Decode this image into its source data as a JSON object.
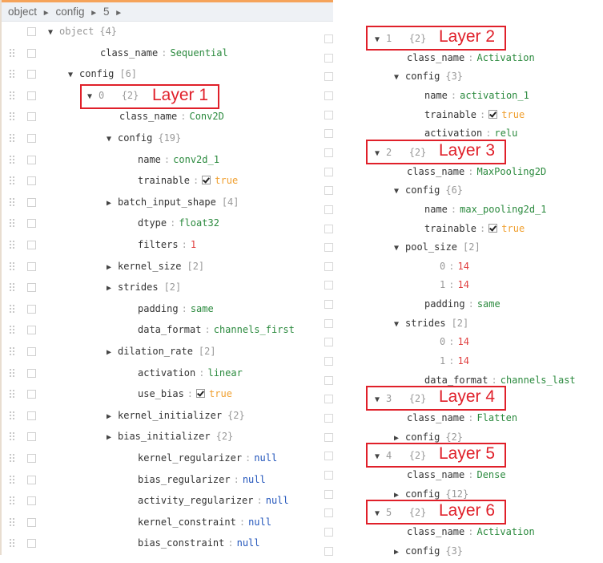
{
  "breadcrumb": {
    "items": [
      "object",
      "config",
      "5"
    ],
    "separator": "►"
  },
  "colors": {
    "accent_top": "#f5a35a",
    "string": "#2b8a3e",
    "number": "#e04040",
    "boolean": "#f0a030",
    "null": "#2255bb",
    "annotation": "#e0202a"
  },
  "left": {
    "rows": [
      {
        "indent": 0,
        "toggle": "▼",
        "key": "object",
        "meta": "{4}",
        "keyMuted": true,
        "grip": false
      },
      {
        "indent": 2,
        "key": "class_name",
        "value": "Sequential",
        "type": "str"
      },
      {
        "indent": 1,
        "toggle": "▼",
        "key": "config",
        "meta": "[6]"
      },
      {
        "indent": 2,
        "toggle": "▼",
        "idx": "0",
        "meta": "{2}"
      },
      {
        "indent": 4,
        "key": "class_name",
        "value": "Conv2D",
        "type": "str"
      },
      {
        "indent": 3,
        "toggle": "▼",
        "key": "config",
        "meta": "{19}"
      },
      {
        "indent": 5,
        "key": "name",
        "value": "conv2d_1",
        "type": "str"
      },
      {
        "indent": 5,
        "key": "trainable",
        "value": "true",
        "type": "bool",
        "checkbox": true
      },
      {
        "indent": 4,
        "toggle": "▶",
        "key": "batch_input_shape",
        "meta": "[4]"
      },
      {
        "indent": 5,
        "key": "dtype",
        "value": "float32",
        "type": "str"
      },
      {
        "indent": 5,
        "key": "filters",
        "value": "1",
        "type": "num"
      },
      {
        "indent": 4,
        "toggle": "▶",
        "key": "kernel_size",
        "meta": "[2]"
      },
      {
        "indent": 4,
        "toggle": "▶",
        "key": "strides",
        "meta": "[2]"
      },
      {
        "indent": 5,
        "key": "padding",
        "value": "same",
        "type": "str"
      },
      {
        "indent": 5,
        "key": "data_format",
        "value": "channels_first",
        "type": "str"
      },
      {
        "indent": 4,
        "toggle": "▶",
        "key": "dilation_rate",
        "meta": "[2]"
      },
      {
        "indent": 5,
        "key": "activation",
        "value": "linear",
        "type": "str"
      },
      {
        "indent": 5,
        "key": "use_bias",
        "value": "true",
        "type": "bool",
        "checkbox": true
      },
      {
        "indent": 4,
        "toggle": "▶",
        "key": "kernel_initializer",
        "meta": "{2}"
      },
      {
        "indent": 4,
        "toggle": "▶",
        "key": "bias_initializer",
        "meta": "{2}"
      },
      {
        "indent": 5,
        "key": "kernel_regularizer",
        "value": "null",
        "type": "null"
      },
      {
        "indent": 5,
        "key": "bias_regularizer",
        "value": "null",
        "type": "null"
      },
      {
        "indent": 5,
        "key": "activity_regularizer",
        "value": "null",
        "type": "null"
      },
      {
        "indent": 5,
        "key": "kernel_constraint",
        "value": "null",
        "type": "null"
      },
      {
        "indent": 5,
        "key": "bias_constraint",
        "value": "null",
        "type": "null"
      }
    ]
  },
  "right": {
    "rows": [
      {
        "indent": 0,
        "toggle": "▼",
        "idx": "1",
        "meta": "{2}"
      },
      {
        "indent": 2,
        "key": "class_name",
        "value": "Activation",
        "type": "str"
      },
      {
        "indent": 1,
        "toggle": "▼",
        "key": "config",
        "meta": "{3}"
      },
      {
        "indent": 3,
        "key": "name",
        "value": "activation_1",
        "type": "str"
      },
      {
        "indent": 3,
        "key": "trainable",
        "value": "true",
        "type": "bool",
        "checkbox": true
      },
      {
        "indent": 3,
        "key": "activation",
        "value": "relu",
        "type": "str"
      },
      {
        "indent": 0,
        "toggle": "▼",
        "idx": "2",
        "meta": "{2}"
      },
      {
        "indent": 2,
        "key": "class_name",
        "value": "MaxPooling2D",
        "type": "str"
      },
      {
        "indent": 1,
        "toggle": "▼",
        "key": "config",
        "meta": "{6}"
      },
      {
        "indent": 3,
        "key": "name",
        "value": "max_pooling2d_1",
        "type": "str"
      },
      {
        "indent": 3,
        "key": "trainable",
        "value": "true",
        "type": "bool",
        "checkbox": true
      },
      {
        "indent": 2,
        "toggle": "▼",
        "key": "pool_size",
        "meta": "[2]"
      },
      {
        "indent": 4,
        "idxKey": "0",
        "value": "14",
        "type": "num"
      },
      {
        "indent": 4,
        "idxKey": "1",
        "value": "14",
        "type": "num"
      },
      {
        "indent": 3,
        "key": "padding",
        "value": "same",
        "type": "str"
      },
      {
        "indent": 2,
        "toggle": "▼",
        "key": "strides",
        "meta": "[2]"
      },
      {
        "indent": 4,
        "idxKey": "0",
        "value": "14",
        "type": "num"
      },
      {
        "indent": 4,
        "idxKey": "1",
        "value": "14",
        "type": "num"
      },
      {
        "indent": 3,
        "key": "data_format",
        "value": "channels_last",
        "type": "str"
      },
      {
        "indent": 0,
        "toggle": "▼",
        "idx": "3",
        "meta": "{2}"
      },
      {
        "indent": 2,
        "key": "class_name",
        "value": "Flatten",
        "type": "str"
      },
      {
        "indent": 1,
        "toggle": "▶",
        "key": "config",
        "meta": "{2}"
      },
      {
        "indent": 0,
        "toggle": "▼",
        "idx": "4",
        "meta": "{2}"
      },
      {
        "indent": 2,
        "key": "class_name",
        "value": "Dense",
        "type": "str"
      },
      {
        "indent": 1,
        "toggle": "▶",
        "key": "config",
        "meta": "{12}"
      },
      {
        "indent": 0,
        "toggle": "▼",
        "idx": "5",
        "meta": "{2}"
      },
      {
        "indent": 2,
        "key": "class_name",
        "value": "Activation",
        "type": "str"
      },
      {
        "indent": 1,
        "toggle": "▶",
        "key": "config",
        "meta": "{3}"
      }
    ]
  },
  "annotations": [
    {
      "label": "Layer 1",
      "panel": "left",
      "row": 3
    },
    {
      "label": "Layer 2",
      "panel": "right",
      "row": 0
    },
    {
      "label": "Layer 3",
      "panel": "right",
      "row": 6
    },
    {
      "label": "Layer 4",
      "panel": "right",
      "row": 19
    },
    {
      "label": "Layer 5",
      "panel": "right",
      "row": 22
    },
    {
      "label": "Layer 6",
      "panel": "right",
      "row": 25
    }
  ]
}
